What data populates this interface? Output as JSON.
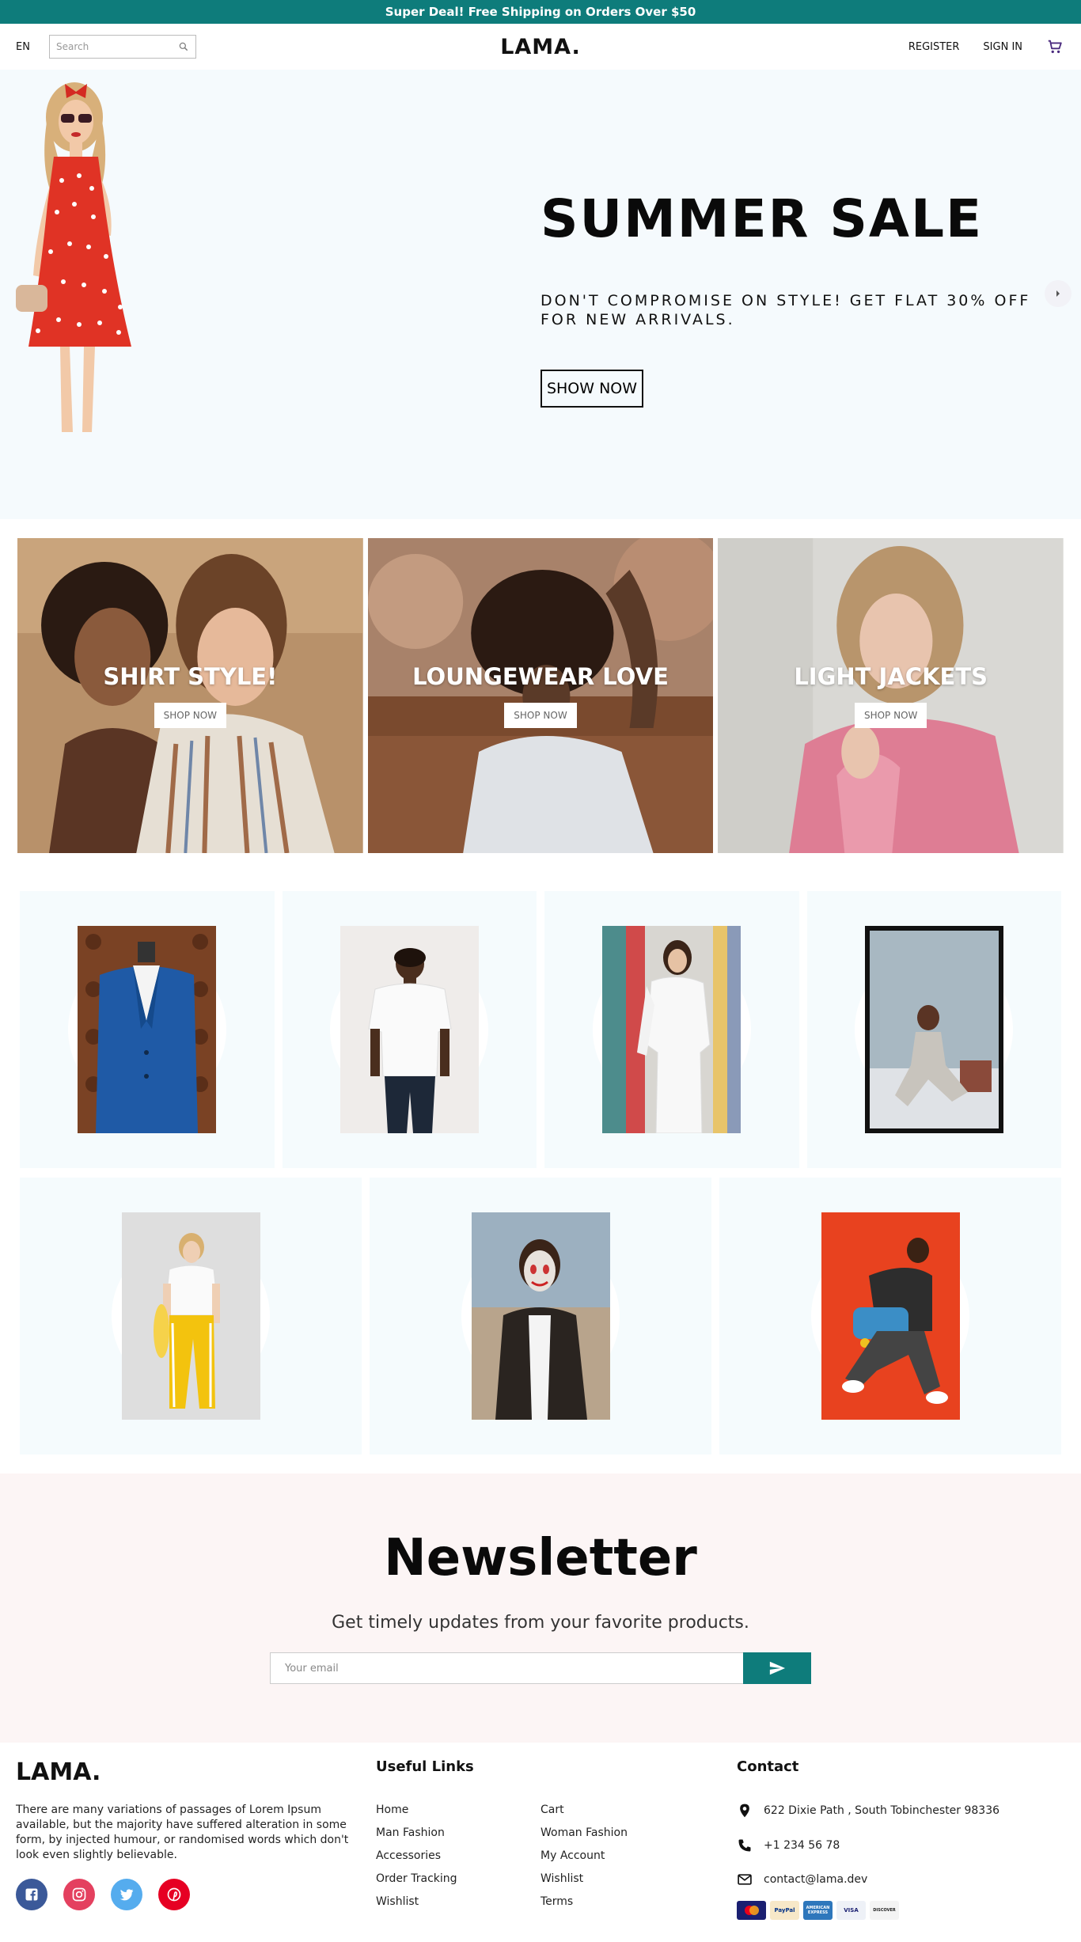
{
  "announcement": "Super Deal! Free Shipping on Orders Over $50",
  "nav": {
    "language": "EN",
    "search_placeholder": "Search",
    "logo": "LAMA.",
    "register": "REGISTER",
    "sign_in": "SIGN IN"
  },
  "hero": {
    "title": "SUMMER SALE",
    "description": "DON'T COMPROMISE ON STYLE! GET FLAT 30% OFF FOR NEW ARRIVALS.",
    "button": "SHOW NOW"
  },
  "categories": [
    {
      "title": "SHIRT STYLE!",
      "button": "SHOP NOW"
    },
    {
      "title": "LOUNGEWEAR LOVE",
      "button": "SHOP NOW"
    },
    {
      "title": "LIGHT JACKETS",
      "button": "SHOP NOW"
    }
  ],
  "newsletter": {
    "title": "Newsletter",
    "description": "Get timely updates from your favorite products.",
    "placeholder": "Your email"
  },
  "footer": {
    "logo": "LAMA.",
    "description": "There are many variations of passages of Lorem Ipsum available, but the majority have suffered alteration in some form, by injected humour, or randomised words which don't look even slightly believable.",
    "useful_links_title": "Useful Links",
    "links": [
      "Home",
      "Cart",
      "Man Fashion",
      "Woman Fashion",
      "Accessories",
      "My Account",
      "Order Tracking",
      "Wishlist",
      "Wishlist",
      "Terms"
    ],
    "contact_title": "Contact",
    "address": "622 Dixie Path , South Tobinchester 98336",
    "phone": "+1 234 56 78",
    "email": "contact@lama.dev",
    "payment_methods": [
      "MasterCard",
      "PayPal",
      "AMERICAN EXPRESS",
      "VISA",
      "DISCOVER"
    ]
  },
  "colors": {
    "accent": "#0e7c7b",
    "hero_bg": "#f5fafd",
    "newsletter_bg": "#fcf5f5",
    "facebook": "#3b5999",
    "instagram": "#e4405f",
    "twitter": "#55acee",
    "pinterest": "#e60023"
  }
}
